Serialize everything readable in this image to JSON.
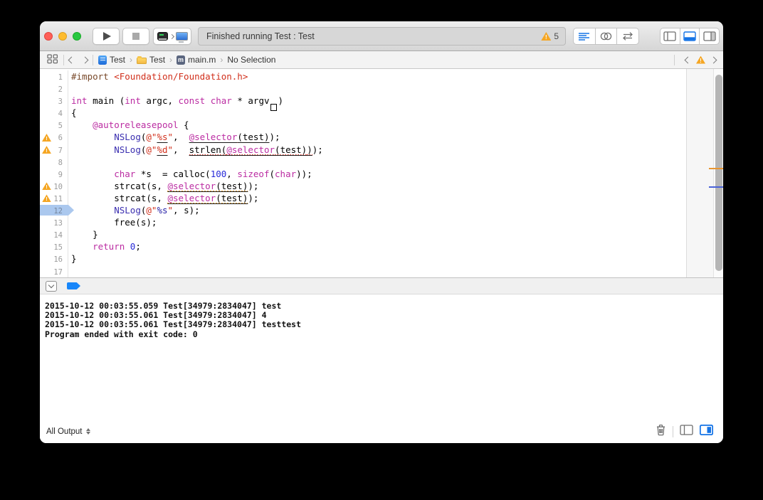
{
  "toolbar": {
    "status_text": "Finished running Test : Test",
    "warning_count": "5"
  },
  "jumpbar": {
    "crumbs": [
      {
        "label": "Test",
        "icon": "project-icon"
      },
      {
        "label": "Test",
        "icon": "folder-icon"
      },
      {
        "label": "main.m",
        "icon": "objc-file-icon"
      },
      {
        "label": "No Selection",
        "icon": null
      }
    ]
  },
  "editor": {
    "palette": {
      "pln": "#000000",
      "kw": "#BB2CA2",
      "str": "#D12F1B",
      "num": "#272AD8",
      "fn": "#3B2FB0",
      "pre": "#78492A",
      "fmt": "#2822A8"
    },
    "lines": [
      {
        "n": 1,
        "tokens": [
          {
            "t": "#import ",
            "c": "pre"
          },
          {
            "t": "<Foundation/Foundation.h>",
            "c": "str"
          }
        ]
      },
      {
        "n": 2,
        "tokens": []
      },
      {
        "n": 3,
        "tokens": [
          {
            "t": "int",
            "c": "kw"
          },
          {
            "t": " main (",
            "c": "pln"
          },
          {
            "t": "int",
            "c": "kw"
          },
          {
            "t": " argc, ",
            "c": "pln"
          },
          {
            "t": "const",
            "c": "kw"
          },
          {
            "t": " ",
            "c": "pln"
          },
          {
            "t": "char",
            "c": "kw"
          },
          {
            "t": " * argv",
            "c": "pln"
          },
          {
            "t": "[]",
            "c": "boxglyph"
          },
          {
            "t": ")",
            "c": "pln"
          }
        ]
      },
      {
        "n": 4,
        "tokens": [
          {
            "t": "{",
            "c": "pln"
          }
        ]
      },
      {
        "n": 5,
        "tokens": [
          {
            "t": "    ",
            "c": "pln"
          },
          {
            "t": "@autoreleasepool",
            "c": "kw"
          },
          {
            "t": " {",
            "c": "pln"
          }
        ]
      },
      {
        "n": 6,
        "warn": true,
        "tokens": [
          {
            "t": "        ",
            "c": "pln"
          },
          {
            "t": "NSLog",
            "c": "fn"
          },
          {
            "t": "(",
            "c": "pln"
          },
          {
            "t": "@\"",
            "c": "str"
          },
          {
            "t": "%s",
            "c": "str",
            "u": "solid"
          },
          {
            "t": "\"",
            "c": "str"
          },
          {
            "t": ",  ",
            "c": "pln"
          },
          {
            "t": "@selector",
            "c": "kw",
            "u": "solid reddot"
          },
          {
            "t": "(test)",
            "c": "pln",
            "u": "solid reddot"
          },
          {
            "t": ");",
            "c": "pln"
          }
        ]
      },
      {
        "n": 7,
        "warn": true,
        "tokens": [
          {
            "t": "        ",
            "c": "pln"
          },
          {
            "t": "NSLog",
            "c": "fn"
          },
          {
            "t": "(",
            "c": "pln"
          },
          {
            "t": "@\"",
            "c": "str"
          },
          {
            "t": "%d",
            "c": "str",
            "u": "solid"
          },
          {
            "t": "\"",
            "c": "str"
          },
          {
            "t": ",  ",
            "c": "pln"
          },
          {
            "t": "strlen(",
            "c": "pln",
            "u": "solid reddot"
          },
          {
            "t": "@selector",
            "c": "kw",
            "u": "solid reddot"
          },
          {
            "t": "(test)",
            "c": "pln",
            "u": "solid reddot"
          },
          {
            "t": ")",
            "c": "pln",
            "u": "solid reddot"
          },
          {
            "t": ");",
            "c": "pln"
          }
        ]
      },
      {
        "n": 8,
        "tokens": []
      },
      {
        "n": 9,
        "tokens": [
          {
            "t": "        ",
            "c": "pln"
          },
          {
            "t": "char",
            "c": "kw"
          },
          {
            "t": " *s  = calloc(",
            "c": "pln"
          },
          {
            "t": "100",
            "c": "num"
          },
          {
            "t": ", ",
            "c": "pln"
          },
          {
            "t": "sizeof",
            "c": "kw"
          },
          {
            "t": "(",
            "c": "pln"
          },
          {
            "t": "char",
            "c": "kw"
          },
          {
            "t": "));",
            "c": "pln"
          }
        ]
      },
      {
        "n": 10,
        "warn": true,
        "tokens": [
          {
            "t": "        strcat(s, ",
            "c": "pln"
          },
          {
            "t": "@selector",
            "c": "kw",
            "u": "solid wave"
          },
          {
            "t": "(test)",
            "c": "pln",
            "u": "solid wave"
          },
          {
            "t": ");",
            "c": "pln"
          }
        ]
      },
      {
        "n": 11,
        "warn": true,
        "tokens": [
          {
            "t": "        strcat(s, ",
            "c": "pln"
          },
          {
            "t": "@selector",
            "c": "kw",
            "u": "solid wave"
          },
          {
            "t": "(test)",
            "c": "pln",
            "u": "solid wave"
          },
          {
            "t": ");",
            "c": "pln"
          }
        ]
      },
      {
        "n": 12,
        "bp": true,
        "tokens": [
          {
            "t": "        ",
            "c": "pln"
          },
          {
            "t": "NSLog",
            "c": "fn"
          },
          {
            "t": "(",
            "c": "pln"
          },
          {
            "t": "@\"",
            "c": "str"
          },
          {
            "t": "%s",
            "c": "fmt"
          },
          {
            "t": "\"",
            "c": "str"
          },
          {
            "t": ", s);",
            "c": "pln"
          }
        ]
      },
      {
        "n": 13,
        "tokens": [
          {
            "t": "        free(s);",
            "c": "pln"
          }
        ]
      },
      {
        "n": 14,
        "tokens": [
          {
            "t": "    }",
            "c": "pln"
          }
        ]
      },
      {
        "n": 15,
        "tokens": [
          {
            "t": "    ",
            "c": "pln"
          },
          {
            "t": "return",
            "c": "kw"
          },
          {
            "t": " ",
            "c": "pln"
          },
          {
            "t": "0",
            "c": "num"
          },
          {
            "t": ";",
            "c": "pln"
          }
        ]
      },
      {
        "n": 16,
        "tokens": [
          {
            "t": "}",
            "c": "pln"
          }
        ]
      },
      {
        "n": 17,
        "tokens": []
      }
    ]
  },
  "debug": {
    "console_lines": [
      "2015-10-12 00:03:55.059 Test[34979:2834047] test",
      "2015-10-12 00:03:55.061 Test[34979:2834047] 4",
      "2015-10-12 00:03:55.061 Test[34979:2834047] testtest",
      "Program ended with exit code: 0"
    ],
    "filter_label": "All Output"
  },
  "colors": {
    "accent_blue": "#1473E6",
    "warning_orange": "#F5A623",
    "scrollbar_warning_tick": "#E8952F",
    "scrollbar_breakpoint_tick": "#4A63D8",
    "breakpoint_fill": "#ABC8EE"
  }
}
